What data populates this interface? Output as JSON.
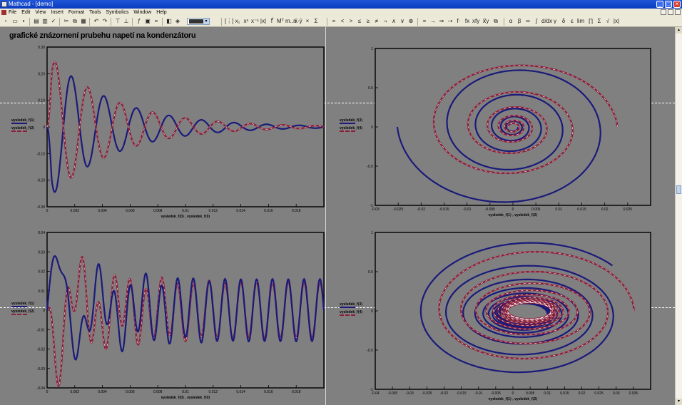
{
  "window": {
    "title": "Mathcad - [demo]",
    "buttons": [
      "_",
      "□",
      "×"
    ]
  },
  "menu": {
    "items": [
      "File",
      "Edit",
      "View",
      "Insert",
      "Format",
      "Tools",
      "Symbolics",
      "Window",
      "Help"
    ]
  },
  "toolbar": {
    "math_symbols": [
      "=",
      "<",
      ">",
      "≤",
      "≥",
      "≠",
      "¬",
      "∧",
      "∨",
      "⊕"
    ],
    "greek": [
      "α",
      "β",
      "γ",
      "δ",
      "ε"
    ]
  },
  "document": {
    "heading": "grafické znázornení prubehu napetí na kondenzátoru"
  },
  "plots": {
    "time_top": {
      "ylim": [
        -0.3,
        0.3
      ],
      "yticks": [
        "0.30",
        "0.20",
        "0.10",
        "0",
        "-0.10",
        "-0.20"
      ],
      "xlim": [
        0,
        0.02
      ],
      "xticks": [
        "0",
        "0.002",
        "0.004",
        "0.006",
        "0.008",
        "0.01",
        "0.012",
        "0.014",
        "0.016",
        "0.018"
      ],
      "xlabel": "vysledek_f⟨0⟩ , vysledek_f⟨0⟩",
      "legend": [
        "vysledek_f⟨1⟩",
        "vysledek_f⟨2⟩"
      ]
    },
    "phase_top": {
      "xlim": [
        -0.03,
        0.03
      ],
      "xticks": [
        "-0.03",
        "-0.025",
        "-0.02",
        "-0.015",
        "-0.01",
        "-0.005",
        "0",
        "0.005",
        "0.01",
        "0.015",
        "0.02",
        "0.025",
        "0.03"
      ],
      "ylim": [
        -1,
        1
      ],
      "yticks": [
        "1",
        "0.5",
        "0",
        "-0.5",
        "-1"
      ],
      "xlabel": "vysledek_f⟨1⟩ , vysledek_f⟨2⟩",
      "legend": [
        "vysledek_f⟨3⟩",
        "vysledek_f⟨4⟩"
      ]
    },
    "time_bottom": {
      "ylim": [
        -0.04,
        0.04
      ],
      "yticks": [
        "0.04",
        "0.03",
        "0.02",
        "0.01",
        "0",
        "-0.01",
        "-0.02",
        "-0.03",
        "-0.04"
      ],
      "xlim": [
        0,
        0.02
      ],
      "xticks": [
        "0",
        "0.002",
        "0.004",
        "0.006",
        "0.008",
        "0.01",
        "0.012",
        "0.014",
        "0.016",
        "0.018"
      ],
      "xlabel": "vysledek_f⟨0⟩ , vysledek_f⟨0⟩",
      "legend": [
        "vysledek_f⟨1⟩",
        "vysledek_f⟨2⟩"
      ]
    },
    "phase_bottom": {
      "xlim": [
        -0.04,
        0.04
      ],
      "xticks": [
        "-0.04",
        "-0.035",
        "-0.03",
        "-0.025",
        "-0.02",
        "-0.015",
        "-0.01",
        "-0.005",
        "0",
        "0.005",
        "0.01",
        "0.015",
        "0.02",
        "0.025",
        "0.03",
        "0.035",
        "0.04"
      ],
      "ylim": [
        -1,
        1
      ],
      "yticks": [
        "1",
        "0.5",
        "0",
        "-0.5",
        "-1"
      ],
      "xlabel": "vysledek_f⟨1⟩ , vysledek_f⟨2⟩",
      "legend": [
        "vysledek_f⟨3⟩",
        "vysledek_f⟨4⟩"
      ]
    }
  },
  "colors": {
    "trace_1": "#1a1a7a",
    "trace_2": "#8a1f3a",
    "plot_bg": "#808080"
  }
}
